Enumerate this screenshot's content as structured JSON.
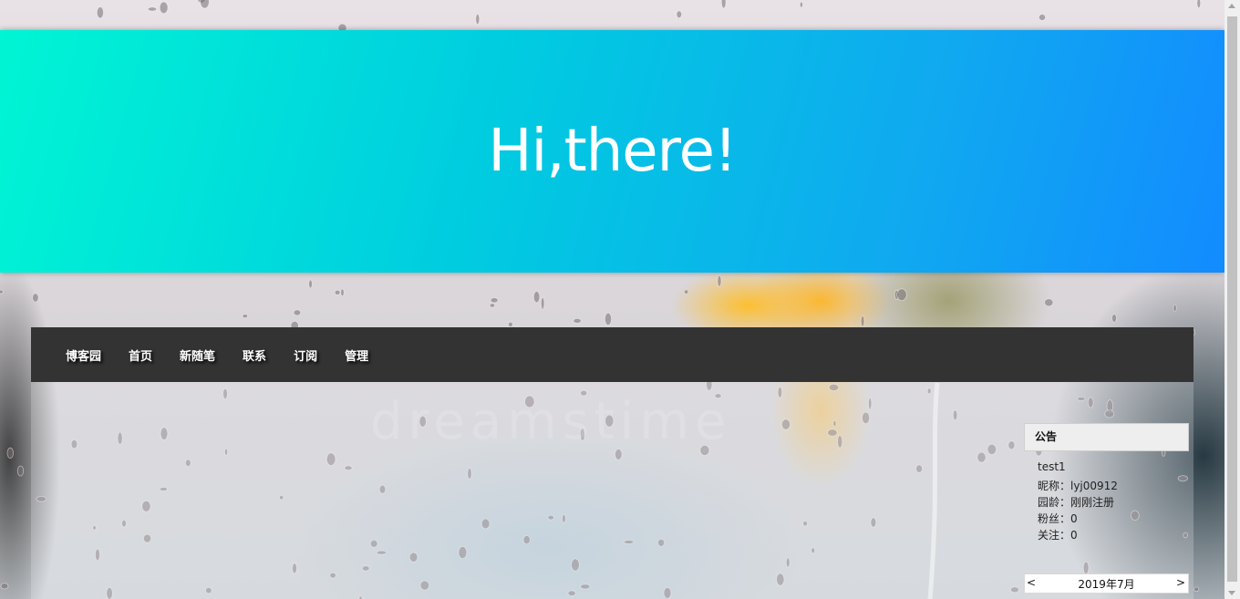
{
  "header": {
    "title": "Hi,there!"
  },
  "nav": {
    "items": [
      {
        "label": "博客园"
      },
      {
        "label": "首页"
      },
      {
        "label": "新随笔"
      },
      {
        "label": "联系"
      },
      {
        "label": "订阅"
      },
      {
        "label": "管理"
      }
    ]
  },
  "sidebar": {
    "notice_title": "公告",
    "notice_text": "test1",
    "nickname": "昵称：lyj00912",
    "age": "园龄：刚刚注册",
    "fans": "粉丝：0",
    "follow": "关注：0"
  },
  "calendar": {
    "prev": "<",
    "month": "2019年7月",
    "next": ">"
  },
  "background": {
    "watermark": "dreamstime"
  },
  "colors": {
    "hero_start": "#00f5d4",
    "hero_end": "#128bff",
    "navbar": "#333333"
  }
}
